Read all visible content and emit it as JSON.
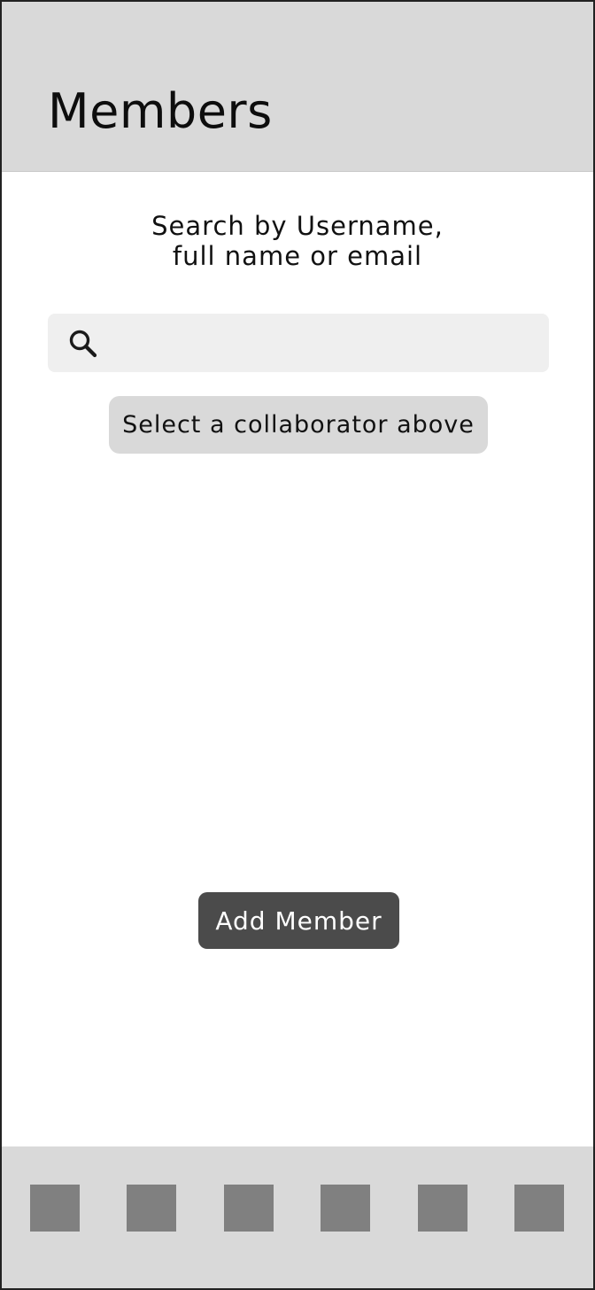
{
  "header": {
    "title": "Members"
  },
  "search": {
    "instructions_line1": "Search by Username,",
    "instructions_line2": "full name or email",
    "value": "",
    "placeholder": "",
    "icon": "search-icon"
  },
  "selection": {
    "placeholder_label": "Select a collaborator above"
  },
  "actions": {
    "add_member_label": "Add Member"
  },
  "bottom_nav": {
    "items": [
      {
        "icon": "nav-placeholder-icon"
      },
      {
        "icon": "nav-placeholder-icon"
      },
      {
        "icon": "nav-placeholder-icon"
      },
      {
        "icon": "nav-placeholder-icon"
      },
      {
        "icon": "nav-placeholder-icon"
      },
      {
        "icon": "nav-placeholder-icon"
      }
    ]
  },
  "colors": {
    "header_bg": "#d9d9d9",
    "search_bg": "#efefef",
    "pill_bg": "#d9d9d9",
    "button_bg": "#4b4b4b",
    "nav_item": "#808080"
  }
}
